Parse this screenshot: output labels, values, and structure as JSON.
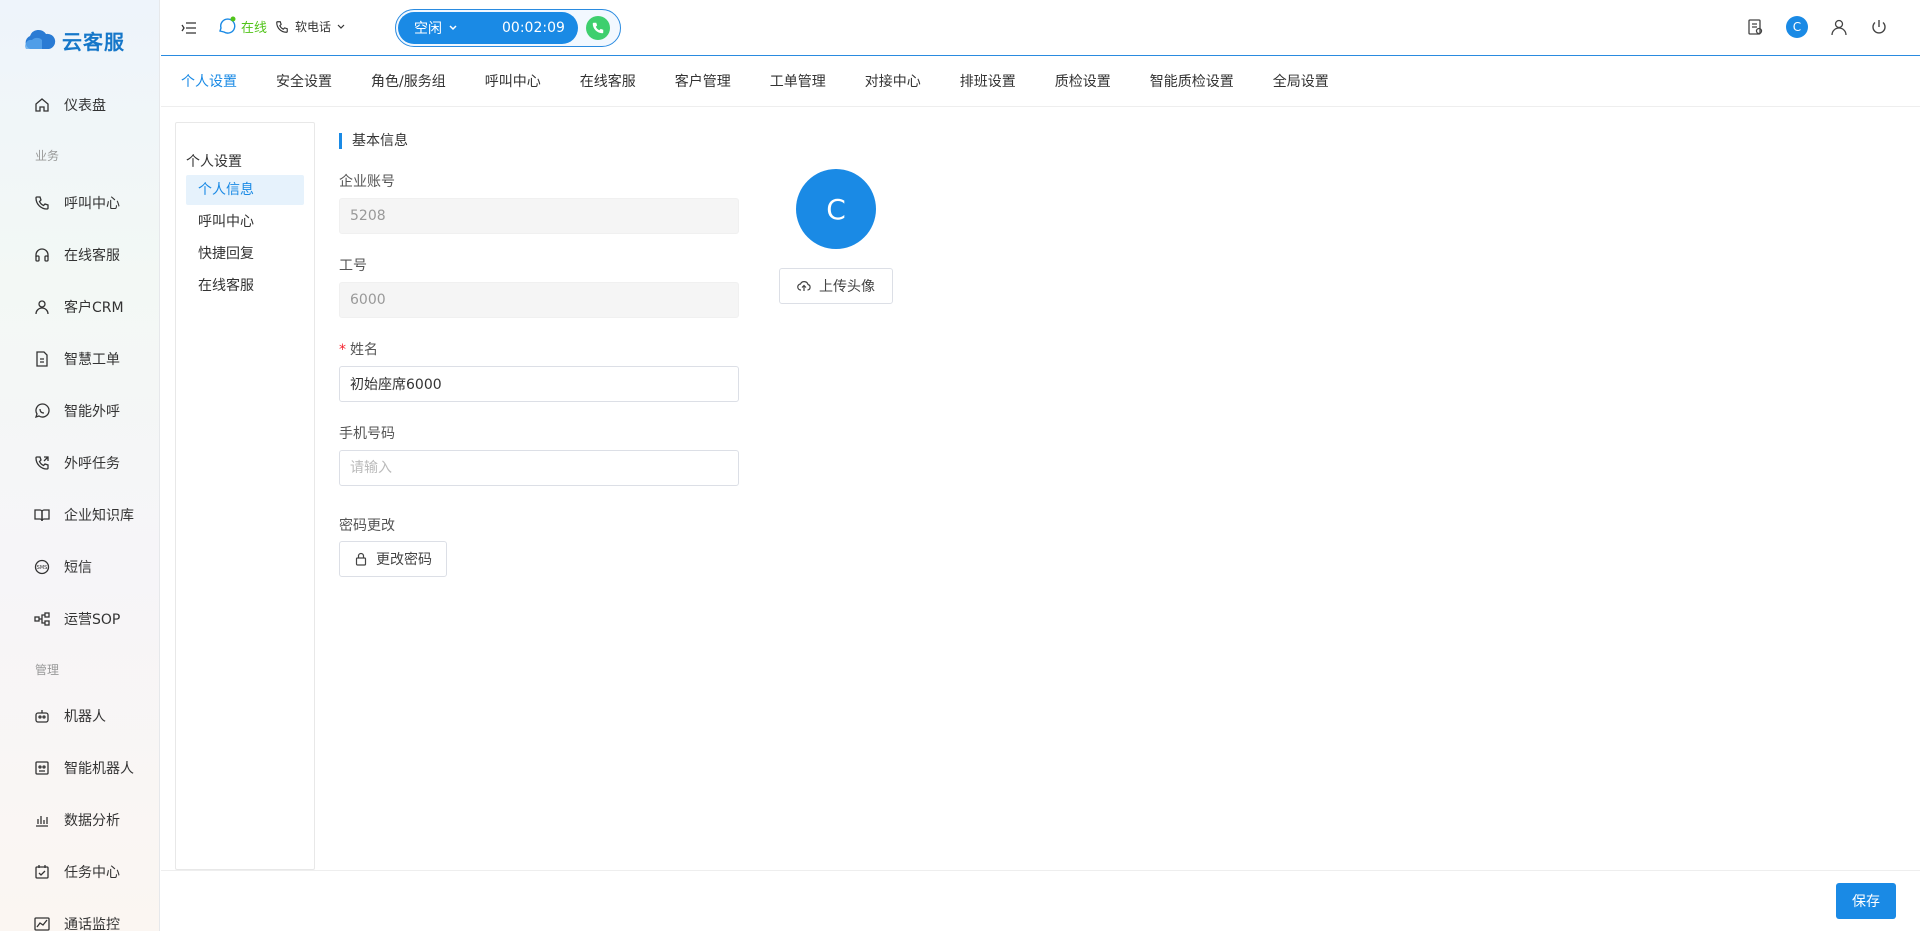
{
  "app": {
    "name": "云客服"
  },
  "sidebar": {
    "dashboard": "仪表盘",
    "group_business": "业务",
    "group_manage": "管理",
    "items": [
      {
        "label": "呼叫中心",
        "icon": "phone-icon"
      },
      {
        "label": "在线客服",
        "icon": "headset-icon"
      },
      {
        "label": "客户CRM",
        "icon": "user-icon"
      },
      {
        "label": "智慧工单",
        "icon": "document-icon"
      },
      {
        "label": "智能外呼",
        "icon": "whatsapp-icon"
      },
      {
        "label": "外呼任务",
        "icon": "phone-outgoing-icon"
      },
      {
        "label": "企业知识库",
        "icon": "book-icon"
      },
      {
        "label": "短信",
        "icon": "sms-icon"
      },
      {
        "label": "运营SOP",
        "icon": "flow-icon"
      }
    ],
    "manage_items": [
      {
        "label": "机器人",
        "icon": "robot-icon"
      },
      {
        "label": "智能机器人",
        "icon": "smart-robot-icon"
      },
      {
        "label": "数据分析",
        "icon": "bar-chart-icon"
      },
      {
        "label": "任务中心",
        "icon": "task-icon"
      },
      {
        "label": "通话监控",
        "icon": "monitor-icon"
      }
    ]
  },
  "header": {
    "status": "在线",
    "phone_mode": "软电话",
    "call_status": "空闲",
    "call_timer": "00:02:09",
    "avatar_letter": "C"
  },
  "tabs": [
    "个人设置",
    "安全设置",
    "角色/服务组",
    "呼叫中心",
    "在线客服",
    "客户管理",
    "工单管理",
    "对接中心",
    "排班设置",
    "质检设置",
    "智能质检设置",
    "全局设置"
  ],
  "submenu": {
    "title": "个人设置",
    "items": [
      "个人信息",
      "呼叫中心",
      "快捷回复",
      "在线客服"
    ]
  },
  "form": {
    "section_title": "基本信息",
    "company_account_label": "企业账号",
    "company_account_value": "5208",
    "work_id_label": "工号",
    "work_id_value": "6000",
    "name_label": "姓名",
    "name_value": "初始座席6000",
    "phone_label": "手机号码",
    "phone_placeholder": "请输入",
    "password_label": "密码更改",
    "change_password_button": "更改密码",
    "avatar_letter": "C",
    "upload_avatar_button": "上传头像"
  },
  "footer": {
    "save_button": "保存"
  },
  "colors": {
    "primary": "#1a8ae5",
    "online": "#52c41a",
    "call_green": "#3ecf6e"
  }
}
